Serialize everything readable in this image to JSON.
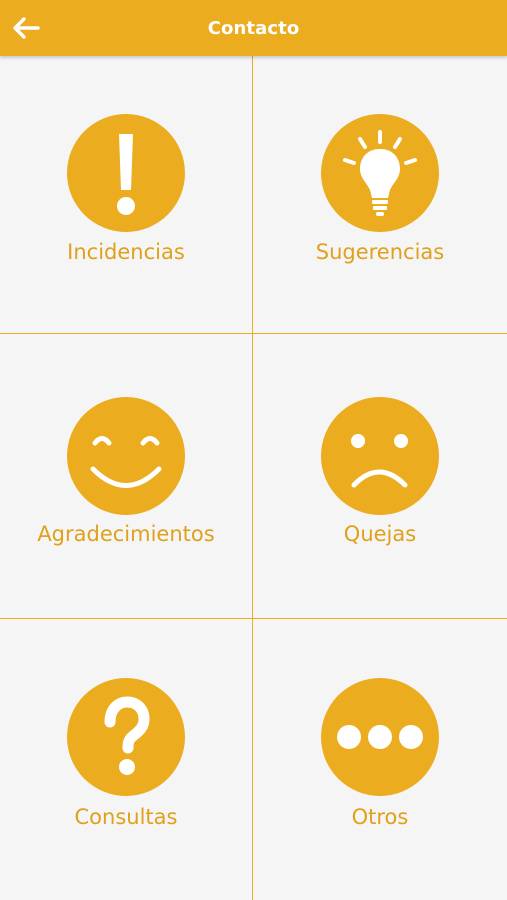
{
  "colors": {
    "accent": "#ecac20",
    "label": "#e0a01a",
    "background": "#f5f5f5",
    "icon_foreground": "#ffffff"
  },
  "header": {
    "title": "Contacto",
    "back_icon": "arrow-left-icon"
  },
  "items": [
    {
      "label": "Incidencias",
      "icon": "exclamation-icon"
    },
    {
      "label": "Sugerencias",
      "icon": "lightbulb-icon"
    },
    {
      "label": "Agradecimientos",
      "icon": "happy-face-icon"
    },
    {
      "label": "Quejas",
      "icon": "sad-face-icon"
    },
    {
      "label": "Consultas",
      "icon": "question-mark-icon"
    },
    {
      "label": "Otros",
      "icon": "ellipsis-icon"
    }
  ]
}
